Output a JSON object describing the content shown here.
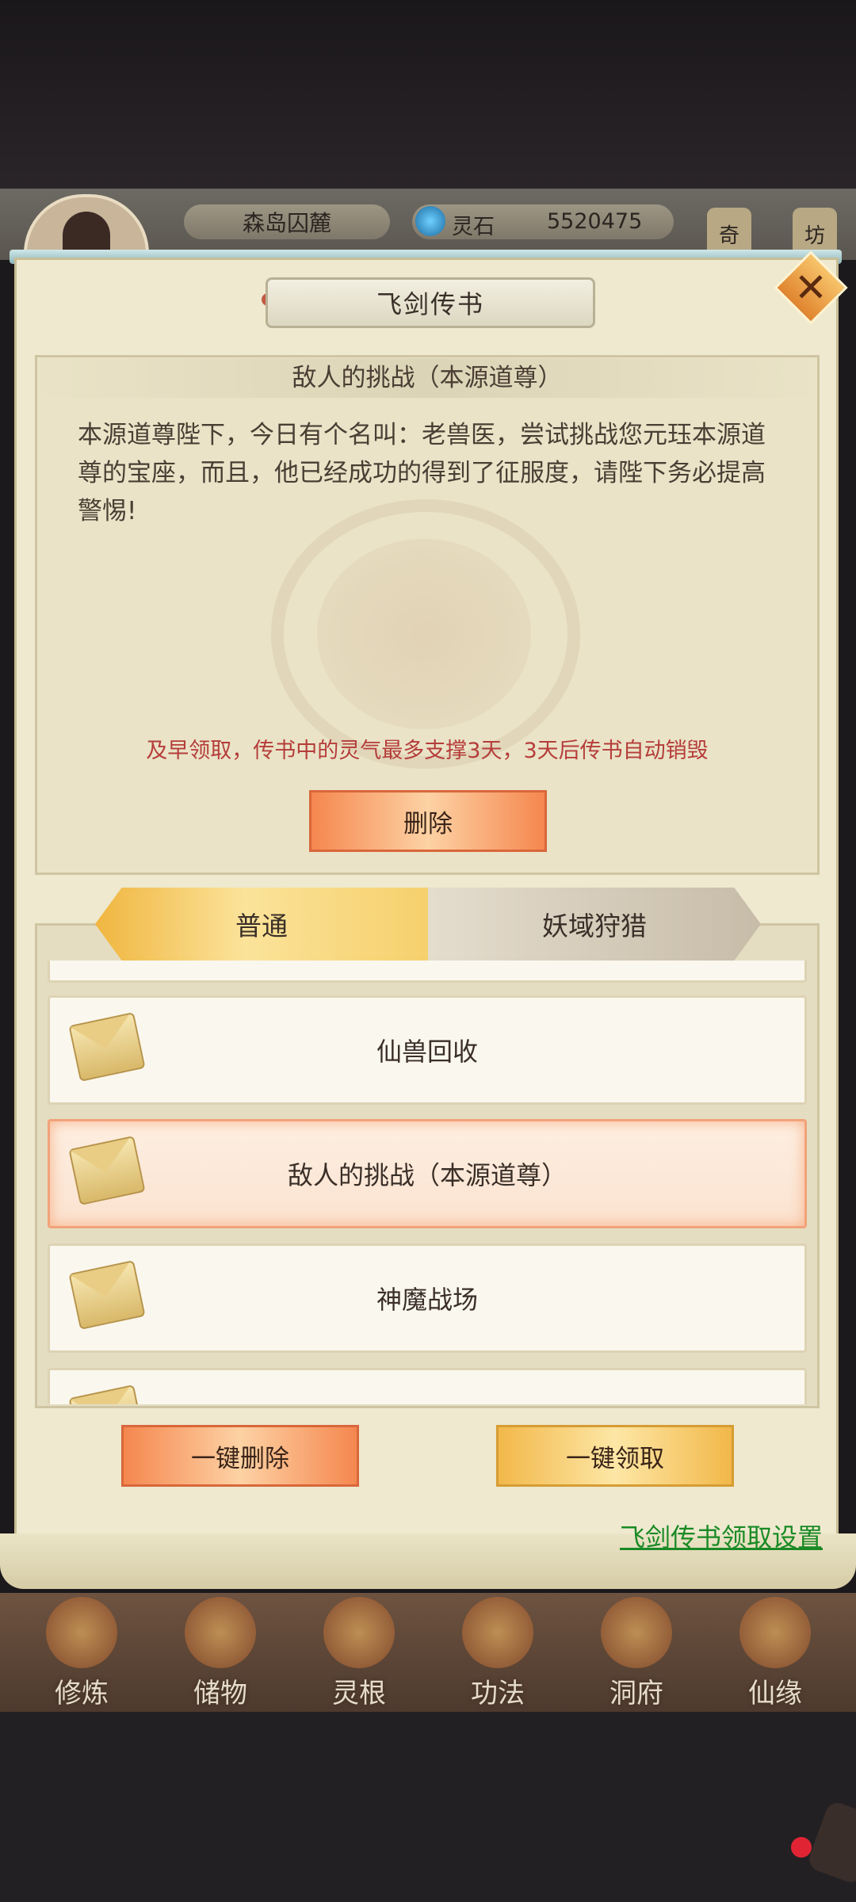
{
  "header": {
    "location": "森岛囚麓",
    "currency_label": "灵石",
    "currency_value": "5520475",
    "side_buttons": [
      "奇",
      "坊"
    ]
  },
  "popup": {
    "title": "飞剑传书",
    "message": {
      "title": "敌人的挑战（本源道尊）",
      "body": "本源道尊陛下，今日有个名叫：老兽医，尝试挑战您元珏本源道尊的宝座，而且，他已经成功的得到了征服度，请陛下务必提高警惕!",
      "warning": "及早领取，传书中的灵气最多支撑3天，3天后传书自动销毁",
      "delete_label": "删除"
    },
    "tabs": [
      {
        "label": "普通",
        "active": true
      },
      {
        "label": "妖域狩猎",
        "active": false
      }
    ],
    "list": [
      {
        "label": "仙兽回收",
        "selected": false
      },
      {
        "label": "敌人的挑战（本源道尊）",
        "selected": true
      },
      {
        "label": "神魔战场",
        "selected": false
      }
    ],
    "delete_all_label": "一键删除",
    "claim_all_label": "一键领取",
    "settings_link": "飞剑传书领取设置"
  },
  "bottom_nav": [
    {
      "label": "修炼"
    },
    {
      "label": "储物"
    },
    {
      "label": "灵根"
    },
    {
      "label": "功法"
    },
    {
      "label": "洞府"
    },
    {
      "label": "仙缘"
    }
  ]
}
